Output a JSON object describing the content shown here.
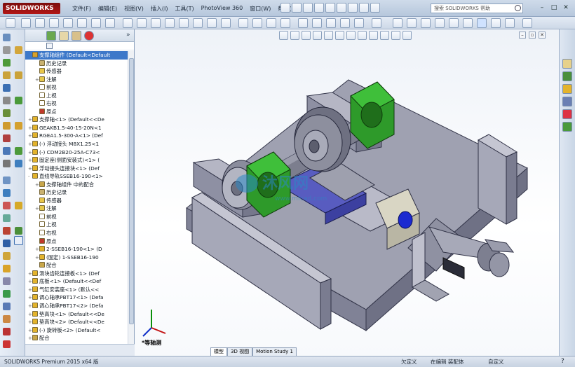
{
  "app": {
    "logo": "SOLIDWORKS",
    "menus": [
      "文件(F)",
      "编辑(E)",
      "视图(V)",
      "插入(I)",
      "工具(T)",
      "PhotoView 360",
      "窗口(W)",
      "帮助(H)"
    ],
    "search_placeholder": "搜索 SOLIDWORKS 帮助",
    "window_controls": [
      "–",
      "□",
      "✕"
    ]
  },
  "feature_tree": {
    "items": [
      {
        "exp": "",
        "label": "支撑轴组件  (Default<Default",
        "icon": "assembly-icon",
        "color": "#d8a12a",
        "selected": true,
        "indent": 0
      },
      {
        "exp": "",
        "label": "历史记录",
        "icon": "history-icon",
        "color": "#c9b170",
        "indent": 1
      },
      {
        "exp": "",
        "label": "传感器",
        "icon": "sensor-icon",
        "color": "#e8c64a",
        "indent": 1
      },
      {
        "exp": "+",
        "label": "注解",
        "icon": "annotation-icon",
        "color": "#e6c84c",
        "indent": 1
      },
      {
        "exp": "",
        "label": "前视",
        "icon": "plane-icon",
        "color": "#ffffff",
        "indent": 1
      },
      {
        "exp": "",
        "label": "上视",
        "icon": "plane-icon",
        "color": "#ffffff",
        "indent": 1
      },
      {
        "exp": "",
        "label": "右视",
        "icon": "plane-icon",
        "color": "#ffffff",
        "indent": 1
      },
      {
        "exp": "",
        "label": "原点",
        "icon": "origin-icon",
        "color": "#c0392b",
        "indent": 1
      },
      {
        "exp": "+",
        "label": "支撑轴<1> (Default<<De",
        "icon": "part-icon",
        "color": "#e3b32c",
        "indent": 0
      },
      {
        "exp": "+",
        "label": "GEAKB1.5-40-15-20N<1",
        "icon": "part-icon",
        "color": "#e3b32c",
        "indent": 0
      },
      {
        "exp": "+",
        "label": "RGEA1.5-300-A<1> (Def",
        "icon": "part-icon",
        "color": "#e3b32c",
        "indent": 0
      },
      {
        "exp": "+",
        "label": "(-) 浮动接头 M8X1.25<1",
        "icon": "part-icon",
        "color": "#e3b32c",
        "indent": 0
      },
      {
        "exp": "+",
        "label": "(-) CDM2B20-25A-C73<",
        "icon": "part-icon",
        "color": "#e3b32c",
        "indent": 0
      },
      {
        "exp": "+",
        "label": "固定座(侧面安装式)<1> (",
        "icon": "part-icon",
        "color": "#e3b32c",
        "indent": 0
      },
      {
        "exp": "+",
        "label": "浮动接头连接块<1> (Def",
        "icon": "part-icon",
        "color": "#e3b32c",
        "indent": 0
      },
      {
        "exp": "-",
        "label": "直线导轨SSEB16-190<1>",
        "icon": "subassembly-icon",
        "color": "#e3b32c",
        "indent": 0
      },
      {
        "exp": "+",
        "label": "支撑轴组件 中的配合",
        "icon": "mate-icon",
        "color": "#c8a64a",
        "indent": 1
      },
      {
        "exp": "",
        "label": "历史记录",
        "icon": "history-icon",
        "color": "#c9b170",
        "indent": 1
      },
      {
        "exp": "",
        "label": "传感器",
        "icon": "sensor-icon",
        "color": "#e8c64a",
        "indent": 1
      },
      {
        "exp": "+",
        "label": "注解",
        "icon": "annotation-icon",
        "color": "#e6c84c",
        "indent": 1
      },
      {
        "exp": "",
        "label": "前视",
        "icon": "plane-icon",
        "color": "#ffffff",
        "indent": 1
      },
      {
        "exp": "",
        "label": "上视",
        "icon": "plane-icon",
        "color": "#ffffff",
        "indent": 1
      },
      {
        "exp": "",
        "label": "右视",
        "icon": "plane-icon",
        "color": "#ffffff",
        "indent": 1
      },
      {
        "exp": "",
        "label": "原点",
        "icon": "origin-icon",
        "color": "#c0392b",
        "indent": 1
      },
      {
        "exp": "+",
        "label": "2-SSEB16-190<1> (D",
        "icon": "part-icon",
        "color": "#e3b32c",
        "indent": 1
      },
      {
        "exp": "+",
        "label": "(固定) 1-SSEB16-190",
        "icon": "part-icon",
        "color": "#e3b32c",
        "indent": 1
      },
      {
        "exp": "",
        "label": "配合",
        "icon": "mate-icon",
        "color": "#c8a64a",
        "indent": 1
      },
      {
        "exp": "+",
        "label": "滑块齿轮连接板<1> (Def",
        "icon": "part-icon",
        "color": "#e3b32c",
        "indent": 0
      },
      {
        "exp": "+",
        "label": "底板<1> (Default<<Def",
        "icon": "part-icon",
        "color": "#e3b32c",
        "indent": 0
      },
      {
        "exp": "+",
        "label": "气缸安装座<1> (默认<<",
        "icon": "part-icon",
        "color": "#e3b32c",
        "indent": 0
      },
      {
        "exp": "+",
        "label": "调心轴承PBT17<1> (Defa",
        "icon": "part-icon",
        "color": "#e3b32c",
        "indent": 0
      },
      {
        "exp": "+",
        "label": "调心轴承PBT17<2> (Defa",
        "icon": "part-icon",
        "color": "#e3b32c",
        "indent": 0
      },
      {
        "exp": "+",
        "label": "垫高块<1> (Default<<De",
        "icon": "part-icon",
        "color": "#e3b32c",
        "indent": 0
      },
      {
        "exp": "+",
        "label": "垫高块<2> (Default<<De",
        "icon": "part-icon",
        "color": "#e3b32c",
        "indent": 0
      },
      {
        "exp": "+",
        "label": "(-) 旋转板<2> (Default<",
        "icon": "part-icon",
        "color": "#e3b32c",
        "indent": 0
      },
      {
        "exp": "+",
        "label": "配合",
        "icon": "mate-icon",
        "color": "#c8a64a",
        "indent": 0
      }
    ]
  },
  "viewport": {
    "view_label": "*等轴测",
    "tabs": [
      "模型",
      "3D 视图",
      "Motion Study 1"
    ],
    "active_tab": 0,
    "watermark": "沐风网",
    "watermark_url": "www.mfcad.com"
  },
  "status": {
    "product": "SOLIDWORKS Premium 2015 x64 版",
    "under_defined": "欠定义",
    "editing": "在编辑 装配体",
    "custom": "自定义"
  },
  "colors": {
    "accent": "#3d78c9",
    "bearing_green": "#2e9a2a",
    "plate_grey": "#a9aab8",
    "slider_blue": "#5d62c9"
  }
}
